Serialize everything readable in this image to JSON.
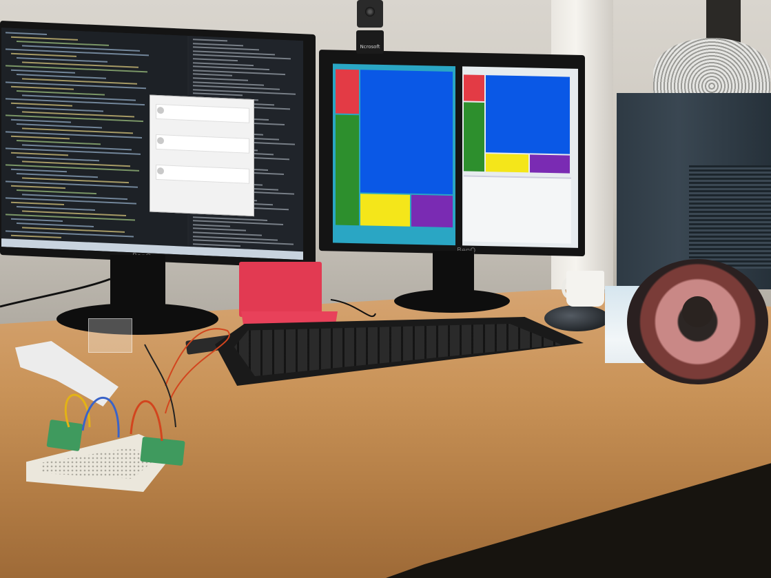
{
  "scene": {
    "monitor_brand_left": "BenQ",
    "monitor_brand_right": "BenQ",
    "webcam_label": "Ncrosoft",
    "colors": {
      "desk": "#c99358",
      "wall": "#d2cec6",
      "tile_red": "#e33b45",
      "tile_blue": "#0a58e6",
      "tile_green": "#2d8f2d",
      "tile_yellow": "#f4e61a",
      "tile_purple": "#7a2bb3",
      "redbox": "#e23a52",
      "tower": "#34414b"
    }
  }
}
